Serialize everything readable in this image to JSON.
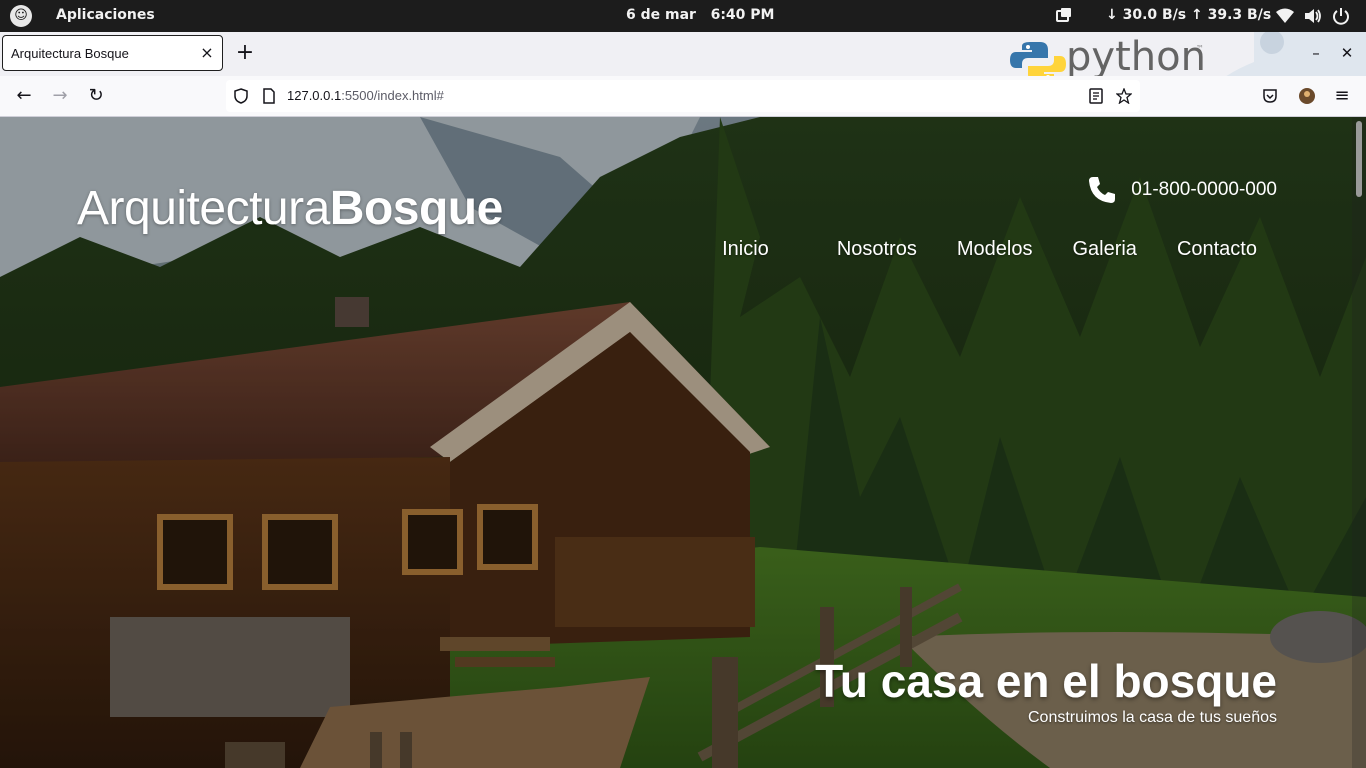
{
  "system_bar": {
    "apps_label": "Aplicaciones",
    "date": "6 de mar",
    "time": "6:40 PM",
    "network_speed": "↓ 30.0 B/s ↑ 39.3 B/s",
    "icons": [
      "os-logo-icon",
      "clipboard-icon",
      "wifi-icon",
      "volume-icon",
      "power-icon"
    ]
  },
  "browser": {
    "tab": {
      "title": "Arquitectura Bosque",
      "close_glyph": "×"
    },
    "new_tab_glyph": "+",
    "watermark": {
      "word": "python",
      "tm": "™"
    },
    "window_controls": {
      "minimize": "–",
      "close": "✕"
    },
    "nav": {
      "back": "←",
      "forward": "→",
      "reload": "↻",
      "menu": "≡"
    },
    "url": {
      "host": "127.0.0.1",
      "rest": ":5500/index.html#"
    }
  },
  "site": {
    "brand": {
      "thin": "Arquitectura",
      "bold": "Bosque"
    },
    "phone": "01-800-0000-000",
    "nav_items": [
      "Inicio",
      "Nosotros",
      "Modelos",
      "Galeria",
      "Contacto"
    ],
    "hero": {
      "title": "Tu casa en el bosque",
      "subtitle": "Construimos la casa de tus sueños"
    }
  },
  "colors": {
    "topbar_bg": "#1c1c1c",
    "tabstrip_bg": "#f0f0f4",
    "navbar_bg": "#f9f9fb",
    "hero_text": "#ffffff",
    "python_blue": "#3776ab",
    "python_yellow": "#ffd43b"
  }
}
